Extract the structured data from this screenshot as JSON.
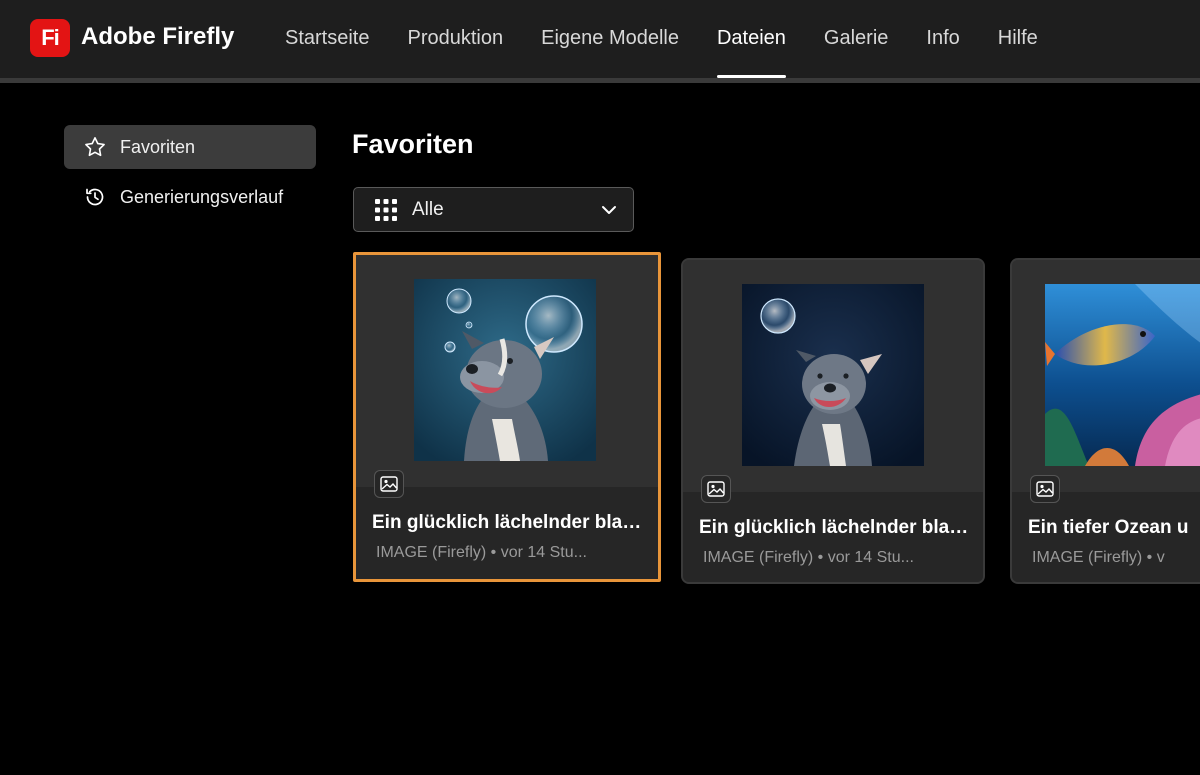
{
  "app": {
    "logo_text": "Fi",
    "brand": "Adobe Firefly",
    "accent": "#e31414"
  },
  "nav": {
    "items": [
      {
        "label": "Startseite",
        "active": false
      },
      {
        "label": "Produktion",
        "active": false
      },
      {
        "label": "Eigene Modelle",
        "active": false
      },
      {
        "label": "Dateien",
        "active": true
      },
      {
        "label": "Galerie",
        "active": false
      },
      {
        "label": "Info",
        "active": false
      },
      {
        "label": "Hilfe",
        "active": false
      }
    ]
  },
  "sidebar": {
    "items": [
      {
        "label": "Favoriten",
        "icon": "star-icon",
        "active": true
      },
      {
        "label": "Generierungsverlauf",
        "icon": "history-icon",
        "active": false
      }
    ]
  },
  "main": {
    "title": "Favoriten",
    "filter": {
      "label": "Alle",
      "icon": "grid-icon"
    },
    "cards": [
      {
        "title": "Ein glücklich lächelnder blau...",
        "subtitle": "IMAGE (Firefly) • vor 14 Stu...",
        "selected": true,
        "thumb": "dog-bubbles-teal"
      },
      {
        "title": "Ein glücklich lächelnder blau...",
        "subtitle": "IMAGE (Firefly) • vor 14 Stu...",
        "selected": false,
        "thumb": "dog-bubble-navy"
      },
      {
        "title": "Ein tiefer Ozean u",
        "subtitle": "IMAGE (Firefly) • v",
        "selected": false,
        "thumb": "ocean-fish"
      }
    ]
  },
  "colors": {
    "selection": "#e8953a",
    "topbar": "#1e1e1e",
    "card": "#2b2b2b"
  }
}
